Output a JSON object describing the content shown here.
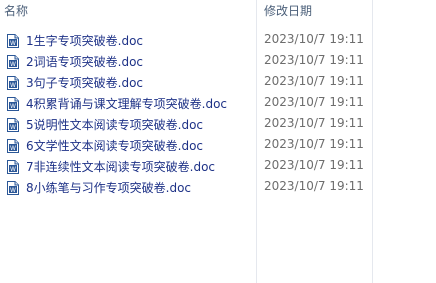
{
  "header": {
    "name_label": "名称",
    "date_label": "修改日期"
  },
  "icons": {
    "file_icon": "word-document-icon",
    "color": "#2b5797"
  },
  "files": [
    {
      "name": "1生字专项突破卷.doc",
      "modified": "2023/10/7 19:11"
    },
    {
      "name": "2词语专项突破卷.doc",
      "modified": "2023/10/7 19:11"
    },
    {
      "name": "3句子专项突破卷.doc",
      "modified": "2023/10/7 19:11"
    },
    {
      "name": "4积累背诵与课文理解专项突破卷.doc",
      "modified": "2023/10/7 19:11"
    },
    {
      "name": "5说明性文本阅读专项突破卷.doc",
      "modified": "2023/10/7 19:11"
    },
    {
      "name": "6文学性文本阅读专项突破卷.doc",
      "modified": "2023/10/7 19:11"
    },
    {
      "name": "7非连续性文本阅读专项突破卷.doc",
      "modified": "2023/10/7 19:11"
    },
    {
      "name": "8小练笔与习作专项突破卷.doc",
      "modified": "2023/10/7 19:11"
    }
  ]
}
